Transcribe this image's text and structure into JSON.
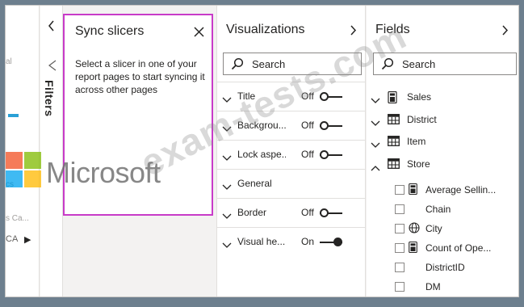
{
  "report": {
    "fragments": [
      "al",
      "cs",
      "CA",
      "s Ca..."
    ]
  },
  "filters_strip": {
    "label": "Filters"
  },
  "sync_slicers": {
    "title": "Sync slicers",
    "description": "Select a slicer in one of your report pages to start syncing it across other pages"
  },
  "visualizations": {
    "title": "Visualizations",
    "search_placeholder": "Search",
    "cards": [
      {
        "label": "Title",
        "toggle_label": "Off",
        "toggle_on": false
      },
      {
        "label": "Backgrou...",
        "toggle_label": "Off",
        "toggle_on": false
      },
      {
        "label": "Lock aspe...",
        "toggle_label": "Off",
        "toggle_on": false
      },
      {
        "label": "General"
      },
      {
        "label": "Border",
        "toggle_label": "Off",
        "toggle_on": false
      },
      {
        "label": "Visual he...",
        "toggle_label": "On",
        "toggle_on": true
      }
    ]
  },
  "fields": {
    "title": "Fields",
    "search_placeholder": "Search",
    "tables": [
      {
        "name": "Sales",
        "icon": "calculator-icon",
        "expanded": false
      },
      {
        "name": "District",
        "icon": "table-icon",
        "expanded": false
      },
      {
        "name": "Item",
        "icon": "table-icon",
        "expanded": false
      },
      {
        "name": "Store",
        "icon": "table-icon",
        "expanded": true
      }
    ],
    "store_columns": [
      {
        "name": "Average Sellin...",
        "icon": "calculator-icon"
      },
      {
        "name": "Chain",
        "icon": ""
      },
      {
        "name": "City",
        "icon": "globe-icon"
      },
      {
        "name": "Count of Ope...",
        "icon": "calculator-icon"
      },
      {
        "name": "DistrictID",
        "icon": ""
      },
      {
        "name": "DM",
        "icon": ""
      }
    ]
  },
  "watermarks": {
    "brand": "Microsoft",
    "site": "exam-tests.com"
  },
  "colors": {
    "highlight_border": "#c83bc8",
    "accent_bar": "#2aa0d6"
  }
}
